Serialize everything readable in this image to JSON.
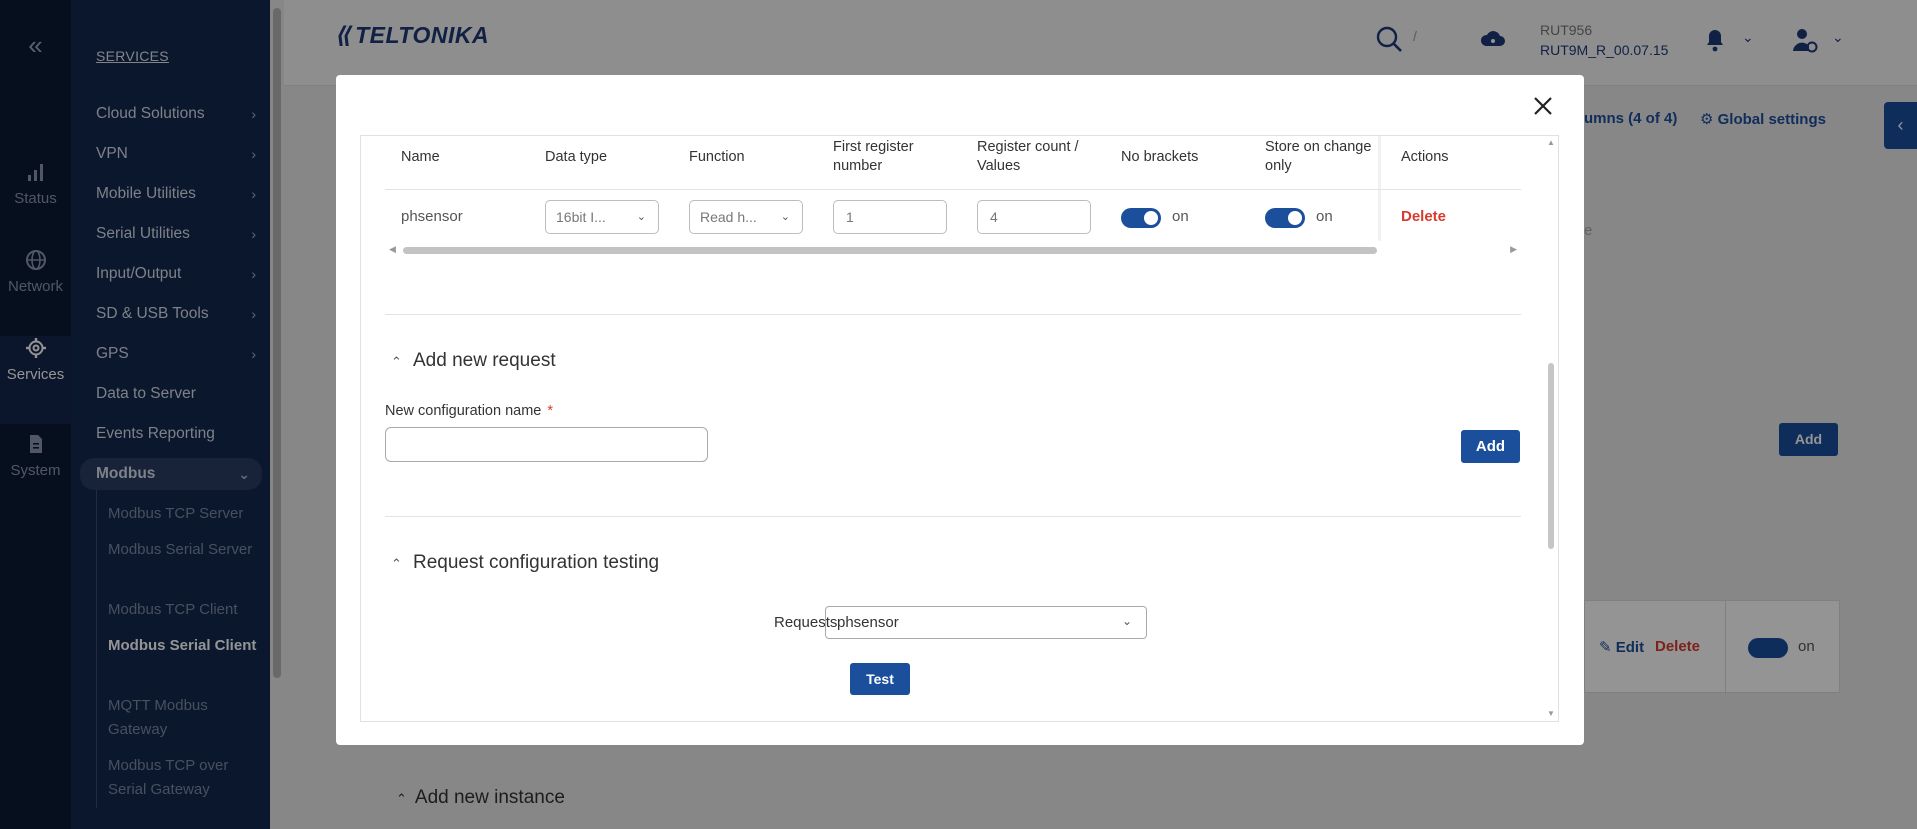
{
  "rail": {
    "collapse_icon": "chevrons-left-icon",
    "items": [
      {
        "label": "Status",
        "icon": "signal-bars-icon"
      },
      {
        "label": "Network",
        "icon": "globe-icon"
      },
      {
        "label": "Services",
        "icon": "gear-icon"
      },
      {
        "label": "System",
        "icon": "file-icon"
      }
    ]
  },
  "subnav": {
    "heading": "SERVICES",
    "items": [
      {
        "label": "Cloud Solutions"
      },
      {
        "label": "VPN"
      },
      {
        "label": "Mobile Utilities"
      },
      {
        "label": "Serial Utilities"
      },
      {
        "label": "Input/Output"
      },
      {
        "label": "SD & USB Tools"
      },
      {
        "label": "GPS"
      },
      {
        "label": "Data to Server"
      },
      {
        "label": "Events Reporting"
      },
      {
        "label": "Modbus"
      }
    ],
    "modbus_children": [
      {
        "label": "Modbus TCP Server"
      },
      {
        "label": "Modbus Serial Server"
      },
      {
        "label": "Modbus TCP Client"
      },
      {
        "label": "Modbus Serial Client"
      },
      {
        "label": "MQTT Modbus Gateway"
      },
      {
        "label": "Modbus TCP over Serial Gateway"
      }
    ]
  },
  "header": {
    "logo_text": "TELTONIKA",
    "search_shortcut": "/",
    "device_model": "RUT956",
    "firmware": "RUT9M_R_00.07.15"
  },
  "background": {
    "columns_link": "umns (4 of 4)",
    "global_settings": "Global settings",
    "add_label": "Add",
    "edit_label": "Edit",
    "delete_label": "Delete",
    "toggle_label": "on",
    "truncated_text": "e",
    "add_instance_title": "Add new instance"
  },
  "modal": {
    "table": {
      "headers": {
        "name": "Name",
        "data_type": "Data type",
        "function": "Function",
        "first_register": "First register number",
        "register_count": "Register count / Values",
        "no_brackets": "No brackets",
        "store_on_change": "Store on change only",
        "actions": "Actions"
      },
      "row": {
        "name": "phsensor",
        "data_type": "16bit I...",
        "function": "Read h...",
        "first_register": "1",
        "register_count": "4",
        "no_brackets": "on",
        "store_on_change": "on",
        "delete": "Delete"
      }
    },
    "add_section": {
      "title": "Add new request",
      "field_label": "New configuration name",
      "required_mark": "*",
      "field_value": "",
      "add_button": "Add"
    },
    "test_section": {
      "title": "Request configuration testing",
      "requests_label": "Requests",
      "requests_value": "phsensor",
      "test_button": "Test"
    }
  },
  "colors": {
    "primary": "#1b4f9c",
    "danger": "#d83b2e",
    "nav_bg": "#14284f",
    "rail_bg": "#0b1a33"
  }
}
